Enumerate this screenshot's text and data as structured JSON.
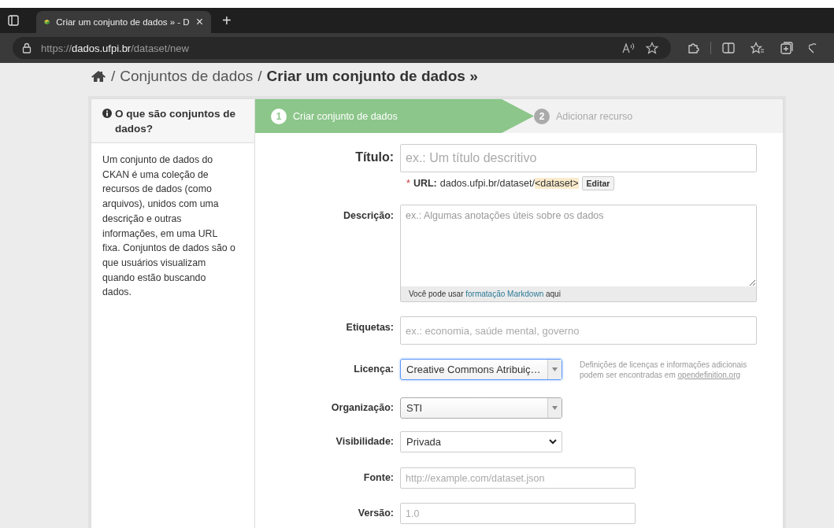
{
  "browser": {
    "tab": {
      "title": "Criar um conjunto de dados » - D",
      "close": "×"
    },
    "new_tab": "+",
    "address": {
      "scheme": "https://",
      "host": "dados.ufpi.br",
      "path": "/dataset/new"
    }
  },
  "breadcrumb": {
    "separator": "/",
    "items": [
      "Conjuntos de dados"
    ],
    "current": "Criar um conjunto de dados »"
  },
  "sidebar": {
    "heading": "O que são conjuntos de dados?",
    "body": "Um conjunto de dados do CKAN é uma coleção de recursos de dados (como arquivos), unidos com uma descrição e outras informações, em uma URL fixa. Conjuntos de dados são o que usuários visualizam quando estão buscando dados."
  },
  "stages": [
    {
      "number": "1",
      "label": "Criar conjunto de dados",
      "selected": true
    },
    {
      "number": "2",
      "label": "Adicionar recurso",
      "selected": false
    }
  ],
  "fields": [
    {
      "kind": "title",
      "label": "Título:",
      "placeholder": "ex.: Um título descritivo",
      "url": {
        "marker": "*",
        "label": "URL:",
        "prefix": "dados.ufpi.br/dataset/",
        "slug": "<dataset>",
        "button": "Editar"
      }
    },
    {
      "kind": "textarea",
      "label": "Descrição:",
      "placeholder": "ex.: Algumas anotações úteis sobre os dados",
      "hint": {
        "before": "Você pode usar",
        "link": "formatação Markdown",
        "after": "aqui"
      }
    },
    {
      "kind": "text",
      "label": "Etiquetas:",
      "placeholder": "ex.: economia, saúde mental, governo"
    },
    {
      "kind": "combo",
      "label": "Licença:",
      "value": "Creative Commons Atribuiç…",
      "focused": true,
      "help": {
        "text": "Definições de licenças e informações adicionais podem ser encontradas em",
        "link": "opendefinition.org"
      }
    },
    {
      "kind": "combo",
      "label": "Organização:",
      "value": "STI",
      "focused": false
    },
    {
      "kind": "select",
      "label": "Visibilidade:",
      "value": "Privada"
    },
    {
      "kind": "short",
      "label": "Fonte:",
      "placeholder": "http://example.com/dataset.json"
    },
    {
      "kind": "short",
      "label": "Versão:",
      "placeholder": "1.0"
    }
  ]
}
